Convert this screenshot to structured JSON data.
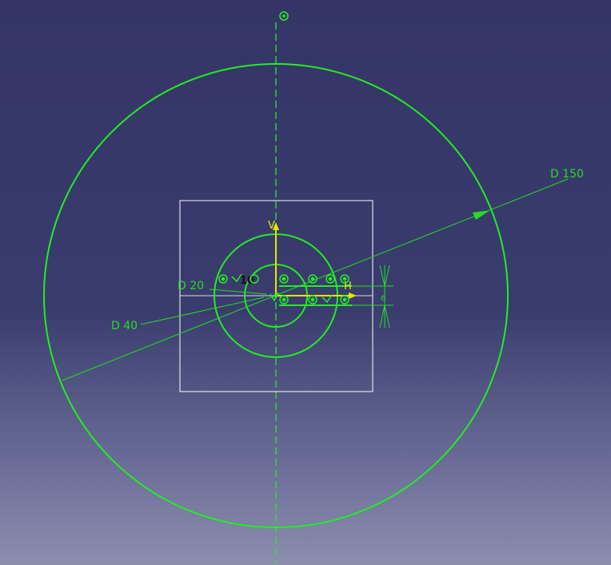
{
  "sketch": {
    "colors": {
      "geometry": "#22ee22",
      "dimension": "#22dd22",
      "axis": "#e6e600",
      "frame": "#ffffff",
      "background_top": "#343566",
      "background_bottom": "#8c8eae"
    },
    "dimensions": {
      "d150": "D 150",
      "d40": "D 40",
      "d20": "D 20",
      "offset": "6"
    },
    "axes": {
      "h": "H",
      "v": "V"
    },
    "constraint_label": "10",
    "icons": [
      "constraint-symbol-icon",
      "coincidence-icon",
      "fix-icon"
    ]
  }
}
